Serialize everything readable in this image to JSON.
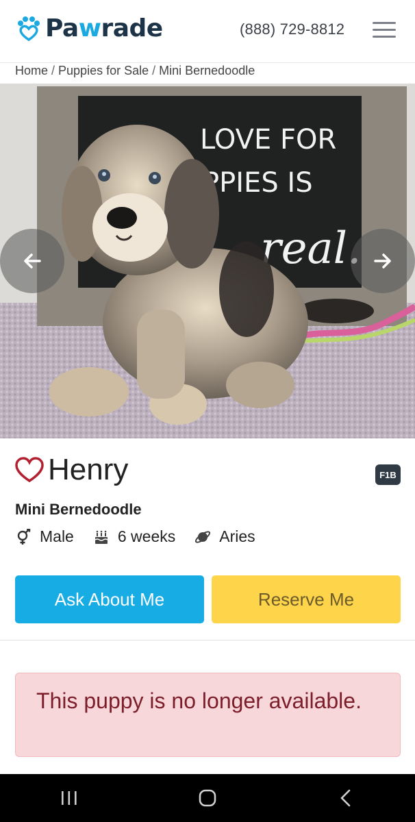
{
  "header": {
    "brand_prefix": "Pa",
    "brand_w": "w",
    "brand_suffix": "rade",
    "phone": "(888) 729-8812",
    "menu_icon": "hamburger-menu-icon",
    "brand_color": "#1d3347",
    "accent_color": "#1aa9e0"
  },
  "breadcrumb": {
    "items": [
      "Home",
      "Puppies for Sale",
      "Mini Bernedoodle"
    ],
    "separator": "/"
  },
  "photo": {
    "sign_lines": [
      "LOVE FOR",
      "PPIES IS",
      "real."
    ],
    "prev_icon": "arrow-left-icon",
    "next_icon": "arrow-right-icon"
  },
  "puppy": {
    "name": "Henry",
    "generation_badge": "F1B",
    "breed": "Mini Bernedoodle",
    "gender": "Male",
    "age": "6 weeks",
    "zodiac": "Aries",
    "favorite_icon": "heart-outline-icon"
  },
  "actions": {
    "ask_label": "Ask About Me",
    "reserve_label": "Reserve Me",
    "ask_color": "#18ace4",
    "reserve_color": "#fed44a"
  },
  "alert": {
    "message": "This puppy is no longer available."
  },
  "system_nav": {
    "recents_icon": "recents-icon",
    "home_icon": "home-icon",
    "back_icon": "back-icon"
  }
}
